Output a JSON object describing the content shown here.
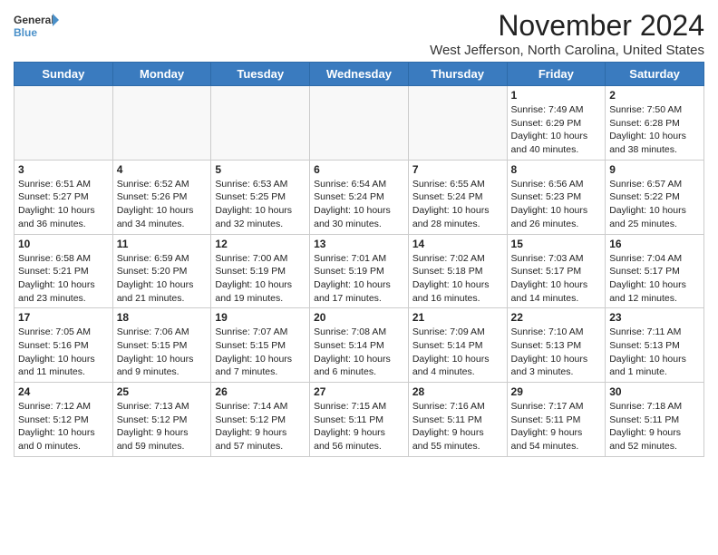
{
  "logo": {
    "line1": "General",
    "line2": "Blue"
  },
  "title": "November 2024",
  "location": "West Jefferson, North Carolina, United States",
  "days_header": [
    "Sunday",
    "Monday",
    "Tuesday",
    "Wednesday",
    "Thursday",
    "Friday",
    "Saturday"
  ],
  "weeks": [
    [
      {
        "day": "",
        "empty": true
      },
      {
        "day": "",
        "empty": true
      },
      {
        "day": "",
        "empty": true
      },
      {
        "day": "",
        "empty": true
      },
      {
        "day": "",
        "empty": true
      },
      {
        "day": "1",
        "info": "Sunrise: 7:49 AM\nSunset: 6:29 PM\nDaylight: 10 hours\nand 40 minutes."
      },
      {
        "day": "2",
        "info": "Sunrise: 7:50 AM\nSunset: 6:28 PM\nDaylight: 10 hours\nand 38 minutes."
      }
    ],
    [
      {
        "day": "3",
        "info": "Sunrise: 6:51 AM\nSunset: 5:27 PM\nDaylight: 10 hours\nand 36 minutes."
      },
      {
        "day": "4",
        "info": "Sunrise: 6:52 AM\nSunset: 5:26 PM\nDaylight: 10 hours\nand 34 minutes."
      },
      {
        "day": "5",
        "info": "Sunrise: 6:53 AM\nSunset: 5:25 PM\nDaylight: 10 hours\nand 32 minutes."
      },
      {
        "day": "6",
        "info": "Sunrise: 6:54 AM\nSunset: 5:24 PM\nDaylight: 10 hours\nand 30 minutes."
      },
      {
        "day": "7",
        "info": "Sunrise: 6:55 AM\nSunset: 5:24 PM\nDaylight: 10 hours\nand 28 minutes."
      },
      {
        "day": "8",
        "info": "Sunrise: 6:56 AM\nSunset: 5:23 PM\nDaylight: 10 hours\nand 26 minutes."
      },
      {
        "day": "9",
        "info": "Sunrise: 6:57 AM\nSunset: 5:22 PM\nDaylight: 10 hours\nand 25 minutes."
      }
    ],
    [
      {
        "day": "10",
        "info": "Sunrise: 6:58 AM\nSunset: 5:21 PM\nDaylight: 10 hours\nand 23 minutes."
      },
      {
        "day": "11",
        "info": "Sunrise: 6:59 AM\nSunset: 5:20 PM\nDaylight: 10 hours\nand 21 minutes."
      },
      {
        "day": "12",
        "info": "Sunrise: 7:00 AM\nSunset: 5:19 PM\nDaylight: 10 hours\nand 19 minutes."
      },
      {
        "day": "13",
        "info": "Sunrise: 7:01 AM\nSunset: 5:19 PM\nDaylight: 10 hours\nand 17 minutes."
      },
      {
        "day": "14",
        "info": "Sunrise: 7:02 AM\nSunset: 5:18 PM\nDaylight: 10 hours\nand 16 minutes."
      },
      {
        "day": "15",
        "info": "Sunrise: 7:03 AM\nSunset: 5:17 PM\nDaylight: 10 hours\nand 14 minutes."
      },
      {
        "day": "16",
        "info": "Sunrise: 7:04 AM\nSunset: 5:17 PM\nDaylight: 10 hours\nand 12 minutes."
      }
    ],
    [
      {
        "day": "17",
        "info": "Sunrise: 7:05 AM\nSunset: 5:16 PM\nDaylight: 10 hours\nand 11 minutes."
      },
      {
        "day": "18",
        "info": "Sunrise: 7:06 AM\nSunset: 5:15 PM\nDaylight: 10 hours\nand 9 minutes."
      },
      {
        "day": "19",
        "info": "Sunrise: 7:07 AM\nSunset: 5:15 PM\nDaylight: 10 hours\nand 7 minutes."
      },
      {
        "day": "20",
        "info": "Sunrise: 7:08 AM\nSunset: 5:14 PM\nDaylight: 10 hours\nand 6 minutes."
      },
      {
        "day": "21",
        "info": "Sunrise: 7:09 AM\nSunset: 5:14 PM\nDaylight: 10 hours\nand 4 minutes."
      },
      {
        "day": "22",
        "info": "Sunrise: 7:10 AM\nSunset: 5:13 PM\nDaylight: 10 hours\nand 3 minutes."
      },
      {
        "day": "23",
        "info": "Sunrise: 7:11 AM\nSunset: 5:13 PM\nDaylight: 10 hours\nand 1 minute."
      }
    ],
    [
      {
        "day": "24",
        "info": "Sunrise: 7:12 AM\nSunset: 5:12 PM\nDaylight: 10 hours\nand 0 minutes."
      },
      {
        "day": "25",
        "info": "Sunrise: 7:13 AM\nSunset: 5:12 PM\nDaylight: 9 hours\nand 59 minutes."
      },
      {
        "day": "26",
        "info": "Sunrise: 7:14 AM\nSunset: 5:12 PM\nDaylight: 9 hours\nand 57 minutes."
      },
      {
        "day": "27",
        "info": "Sunrise: 7:15 AM\nSunset: 5:11 PM\nDaylight: 9 hours\nand 56 minutes."
      },
      {
        "day": "28",
        "info": "Sunrise: 7:16 AM\nSunset: 5:11 PM\nDaylight: 9 hours\nand 55 minutes."
      },
      {
        "day": "29",
        "info": "Sunrise: 7:17 AM\nSunset: 5:11 PM\nDaylight: 9 hours\nand 54 minutes."
      },
      {
        "day": "30",
        "info": "Sunrise: 7:18 AM\nSunset: 5:11 PM\nDaylight: 9 hours\nand 52 minutes."
      }
    ]
  ]
}
